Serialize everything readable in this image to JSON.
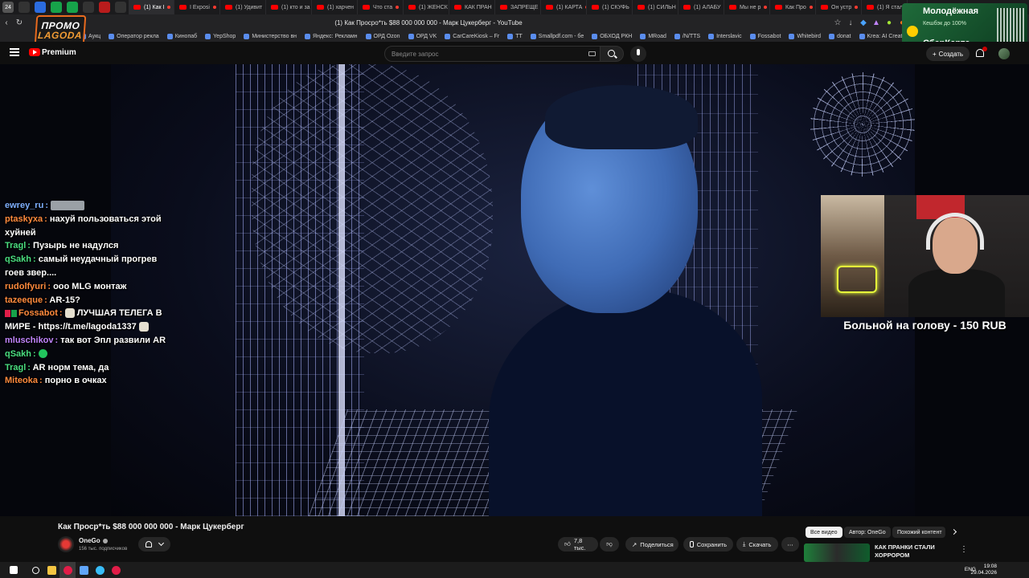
{
  "browser": {
    "tab_count_badge": "24",
    "tabs": [
      {
        "label": "(1) Как I"
      },
      {
        "label": "I Exposi"
      },
      {
        "label": "(1) Удивит"
      },
      {
        "label": "(1) кто и за"
      },
      {
        "label": "(1) харчен"
      },
      {
        "label": "Что ста"
      },
      {
        "label": "(1) ЖЕНСК"
      },
      {
        "label": "КАК ПРАН"
      },
      {
        "label": "ЗАПРЕЩЕ"
      },
      {
        "label": "(1) КАРТА"
      },
      {
        "label": "(1) СКУФЬ"
      },
      {
        "label": "(1) СИЛЬН"
      },
      {
        "label": "(1) АЛАБУ"
      },
      {
        "label": "Мы не р"
      },
      {
        "label": "Как Про"
      },
      {
        "label": "Он устр"
      },
      {
        "label": "(1) Я стал"
      }
    ],
    "page_title": "(1) Как Просро*ть $88 000 000 000 - Марк Цукерберг - YouTube",
    "bookmarks": [
      "Аукц",
      "Оператор рекла",
      "Министерство вн",
      "Яндекс: Рекламн",
      "ОРД Ozon",
      "ОРД VK",
      "CarCareKiosk – Fr",
      "TT",
      "Smallpdf.com - бе",
      "ОБХОД РКН",
      "MRoad",
      "/N/TTS",
      "Interslavic",
      "Fossabot",
      "Whitebird",
      "donat",
      "Krea: AI Creative",
      "кобальт"
    ]
  },
  "bookmarks_extra": [
    "Кинопаб",
    "YepShop"
  ],
  "promo": {
    "line1": "ПРОМО",
    "line2": "LAGODA"
  },
  "sber_ad": {
    "line1": "Молодёжная",
    "line2": "Кешбэк до 100%",
    "line3": "СберКарта"
  },
  "youtube": {
    "premium_label": "Premium",
    "search_placeholder": "Введите запрос",
    "create_label": "Создать",
    "notification_count": "9+"
  },
  "chat": [
    {
      "nick": "ewrey_ru",
      "color": "#7fb0ff",
      "text": "",
      "has_thumb": true
    },
    {
      "nick": "ptaskyxa",
      "color": "#ff8a3d",
      "text": "нахуй пользоваться этой хуйней"
    },
    {
      "nick": "Tragl",
      "color": "#4ade80",
      "text": "Пузырь не надулся"
    },
    {
      "nick": "qSakh",
      "color": "#4ade80",
      "text": "самый неудачный прогрев гоев звер...."
    },
    {
      "nick": "rudolfyuri",
      "color": "#ff8a3d",
      "text": "ооо MLG монтаж"
    },
    {
      "nick": "tazeeque",
      "color": "#ff8a3d",
      "text": "AR-15?"
    },
    {
      "nick": "Fossabot",
      "color": "#ff8a3d",
      "text": "ЛУЧШАЯ ТЕЛЕГА В МИРЕ - https://t.me/lagoda1337",
      "badges": true,
      "emotes": true
    },
    {
      "nick": "mluschikov",
      "color": "#c084fc",
      "text": "так вот Эпл развили AR"
    },
    {
      "nick": "qSakh",
      "color": "#4ade80",
      "text": "",
      "green_emote": true
    },
    {
      "nick": "Tragl",
      "color": "#4ade80",
      "text": "AR норм тема, да"
    },
    {
      "nick": "Miteoka",
      "color": "#ff8a3d",
      "text": "порно в очках"
    }
  ],
  "donation_text": "Больной на голову - 150 RUB",
  "video": {
    "title": "Как Проср*ть $88 000 000 000 - Марк Цукерберг",
    "channel": "OneGo",
    "subscribers": "156 тыс. подписчиков",
    "likes": "7,8 тыс.",
    "share_label": "Поделиться",
    "save_label": "Сохранить",
    "download_label": "Скачать"
  },
  "recommend": {
    "chips": [
      "Все видео",
      "Автор: OneGo",
      "Похожий контент"
    ],
    "item_title": "КАК ПРАНКИ СТАЛИ ХОРРОРОМ"
  },
  "taskbar": {
    "lang": "ENG",
    "time": "19:08",
    "date": "29.04.2026"
  }
}
